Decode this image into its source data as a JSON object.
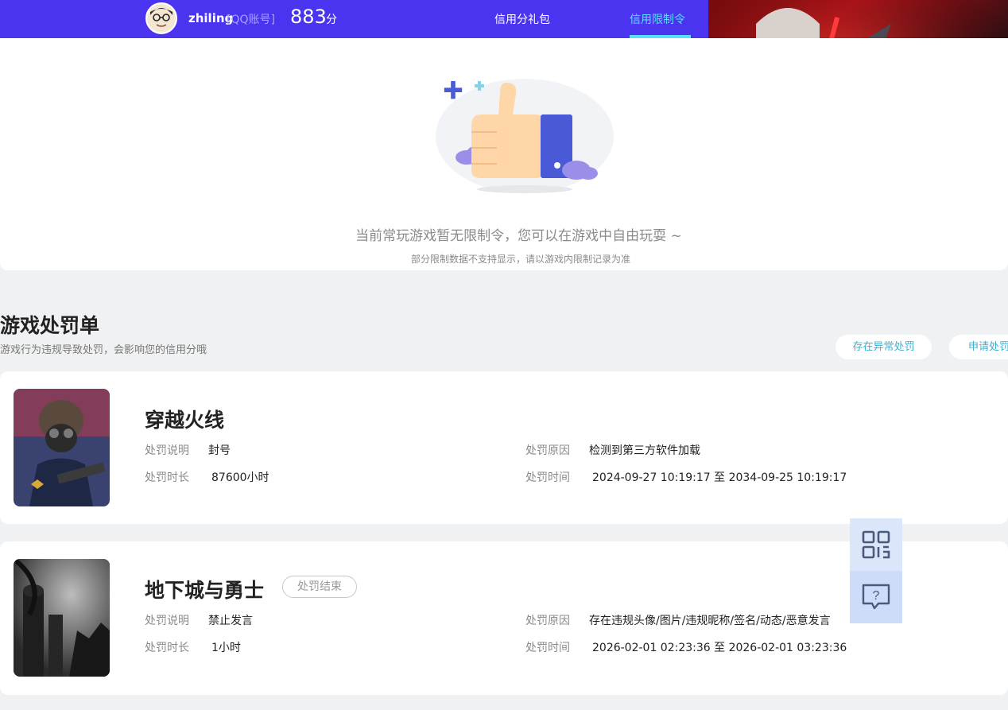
{
  "header": {
    "username": "zhiling",
    "account_type": "[QQ账号]",
    "score": "883",
    "score_unit": "分",
    "nav": {
      "gift": "信用分礼包",
      "limit": "信用限制令"
    },
    "colors": {
      "bar": "#4b34f0",
      "active": "#59e0ff"
    }
  },
  "empty_state": {
    "message": "当前常玩游戏暂无限制令，您可以在游戏中自由玩耍 ~",
    "note": "部分限制数据不支持显示，请以游戏内限制记录为准",
    "icon": "thumbs-up-illustration"
  },
  "section": {
    "title": "游戏处罚单",
    "desc": "游戏行为违规导致处罚，会影响您的信用分哦",
    "buttons": {
      "abnormal": "存在异常处罚",
      "apply": "申请处罚"
    }
  },
  "labels": {
    "desc": "处罚说明",
    "duration": "处罚时长",
    "reason": "处罚原因",
    "time": "处罚时间"
  },
  "penalties": [
    {
      "game": "穿越火线",
      "desc": "封号",
      "duration": "87600小时",
      "reason": "检测到第三方软件加载",
      "time": "2024-09-27 10:19:17 至 2034-09-25 10:19:17",
      "badge": ""
    },
    {
      "game": "地下城与勇士",
      "desc": "禁止发言",
      "duration": "1小时",
      "reason": "存在违规头像/图片/违规昵称/签名/动态/恶意发言",
      "time": "2026-02-01 02:23:36 至 2026-02-01 03:23:36",
      "badge": "处罚结束"
    }
  ],
  "floating": {
    "qr": "qr-code-icon",
    "help": "help-chat-icon"
  }
}
